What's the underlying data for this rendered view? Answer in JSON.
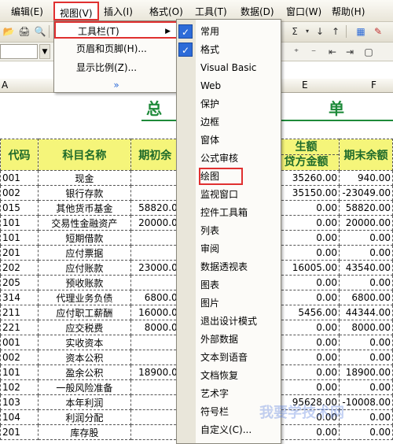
{
  "menubar": {
    "items": [
      {
        "label": "编辑(E)"
      },
      {
        "label": "视图(V)"
      },
      {
        "label": "插入(I)"
      },
      {
        "label": "格式(O)"
      },
      {
        "label": "工具(T)"
      },
      {
        "label": "数据(D)"
      },
      {
        "label": "窗口(W)"
      },
      {
        "label": "帮助(H)"
      }
    ]
  },
  "view_menu": {
    "items": [
      {
        "label": "工具栏(T)",
        "has_submenu": true
      },
      {
        "label": "页眉和页脚(H)..."
      },
      {
        "label": "显示比例(Z)..."
      }
    ],
    "more_indicator": "»"
  },
  "toolbar_submenu": {
    "items": [
      {
        "label": "常用",
        "checked": true
      },
      {
        "label": "格式",
        "checked": true
      },
      {
        "label": "Visual Basic"
      },
      {
        "label": "Web"
      },
      {
        "label": "保护"
      },
      {
        "label": "边框"
      },
      {
        "label": "窗体"
      },
      {
        "label": "公式审核"
      },
      {
        "label": "绘图",
        "highlighted": true
      },
      {
        "label": "监视窗口"
      },
      {
        "label": "控件工具箱"
      },
      {
        "label": "列表"
      },
      {
        "label": "审阅"
      },
      {
        "label": "数据透视表"
      },
      {
        "label": "图表"
      },
      {
        "label": "图片"
      },
      {
        "label": "退出设计模式"
      },
      {
        "label": "外部数据"
      },
      {
        "label": "文本到语音"
      },
      {
        "label": "文档恢复"
      },
      {
        "label": "艺术字"
      },
      {
        "label": "符号栏"
      },
      {
        "label": "自定义(C)..."
      }
    ]
  },
  "sheet": {
    "column_letters": [
      "A",
      "E",
      "F"
    ],
    "title_left": "总",
    "title_right": "单",
    "headers": {
      "code": "代码",
      "name": "科目名称",
      "opening": "期初余",
      "credit_top": "生额",
      "credit": "贷方金额",
      "closing": "期末余额"
    },
    "rows": [
      {
        "code": "001",
        "name": "现金",
        "opening": "",
        "credit": "35260.00",
        "closing": "940.00"
      },
      {
        "code": "002",
        "name": "银行存款",
        "opening": "",
        "credit": "35150.00",
        "closing": "-23049.00"
      },
      {
        "code": "015",
        "name": "其他货币基金",
        "opening": "58820.0",
        "credit": "0.00",
        "closing": "58820.00"
      },
      {
        "code": "101",
        "name": "交易性金融资产",
        "opening": "20000.0",
        "credit": "0.00",
        "closing": "20000.00"
      },
      {
        "code": "101",
        "name": "短期借款",
        "opening": "",
        "credit": "0.00",
        "closing": "0.00"
      },
      {
        "code": "201",
        "name": "应付票据",
        "opening": "",
        "credit": "0.00",
        "closing": "0.00"
      },
      {
        "code": "202",
        "name": "应付账款",
        "opening": "23000.0",
        "credit": "16005.00",
        "closing": "43540.00"
      },
      {
        "code": "205",
        "name": "预收账款",
        "opening": "",
        "credit": "0.00",
        "closing": "0.00"
      },
      {
        "code": "314",
        "name": "代理业务负债",
        "opening": "6800.0",
        "credit": "0.00",
        "closing": "6800.00"
      },
      {
        "code": "211",
        "name": "应付职工薪酬",
        "opening": "16000.0",
        "credit": "5456.00",
        "closing": "44344.00"
      },
      {
        "code": "221",
        "name": "应交税费",
        "opening": "8000.0",
        "credit": "0.00",
        "closing": "8000.00"
      },
      {
        "code": "001",
        "name": "实收资本",
        "opening": "",
        "credit": "0.00",
        "closing": "0.00"
      },
      {
        "code": "002",
        "name": "资本公积",
        "opening": "",
        "credit": "0.00",
        "closing": "0.00"
      },
      {
        "code": "101",
        "name": "盈余公积",
        "opening": "18900.0",
        "credit": "0.00",
        "closing": "18900.00"
      },
      {
        "code": "102",
        "name": "一般风险准备",
        "opening": "",
        "credit": "0.00",
        "closing": "0.00"
      },
      {
        "code": "103",
        "name": "本年利润",
        "opening": "",
        "credit": "95628.00",
        "closing": "-10008.00"
      },
      {
        "code": "104",
        "name": "利润分配",
        "opening": "",
        "credit": "0.00",
        "closing": "0.00"
      },
      {
        "code": "201",
        "name": "库存股",
        "opening": "",
        "credit": "0.00",
        "closing": "0.00"
      }
    ]
  },
  "watermark": "我要学技术网"
}
